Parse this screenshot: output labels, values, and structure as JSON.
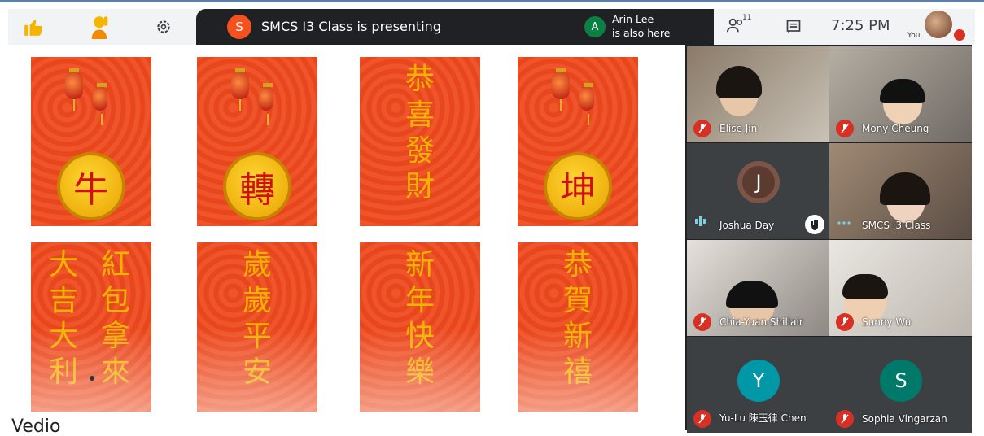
{
  "topbar": {
    "reaction_icons": [
      "thumbs-up-icon",
      "raised-hand-icon",
      "gear-icon"
    ],
    "presenting_initial": "S",
    "presenting_text": "SMCS I3 Class is presenting",
    "also_initial": "A",
    "also_line1": "Arin Lee",
    "also_line2": "is also here",
    "people_count": "11",
    "clock": "7:25 PM",
    "you_label": "You",
    "colors": {
      "banner": "#202124",
      "present_avatar": "#f4511e",
      "also_avatar": "#0b8043"
    }
  },
  "slide": {
    "top_coins": [
      "牛",
      "轉",
      "坤"
    ],
    "top_vertical": [
      "恭",
      "喜",
      "發",
      "財"
    ],
    "bottom_card1_right": [
      "紅",
      "包",
      "拿",
      "來"
    ],
    "bottom_card1_left": [
      "大",
      "吉",
      "大",
      "利"
    ],
    "bottom_card2": [
      "歲",
      "歲",
      "平",
      "安"
    ],
    "bottom_card3": [
      "新",
      "年",
      "快",
      "樂"
    ],
    "bottom_card4": [
      "恭",
      "賀",
      "新",
      "禧"
    ],
    "overlay_label": "Vedio"
  },
  "participants": [
    {
      "name": "Elise Jin",
      "muted": true
    },
    {
      "name": "Mony Cheung",
      "muted": true
    },
    {
      "name": "Joshua Day",
      "initial": "J",
      "muted": false
    },
    {
      "name": "SMCS I3 Class",
      "muted": false
    },
    {
      "name": "Chia-Yuan Shillair",
      "muted": true
    },
    {
      "name": "Sunny Wu",
      "muted": true
    },
    {
      "name": "Yu-Lu 陳玉律 Chen",
      "initial": "Y",
      "muted": true
    },
    {
      "name": "Sophia Vingarzan",
      "initial": "S",
      "muted": true
    }
  ]
}
